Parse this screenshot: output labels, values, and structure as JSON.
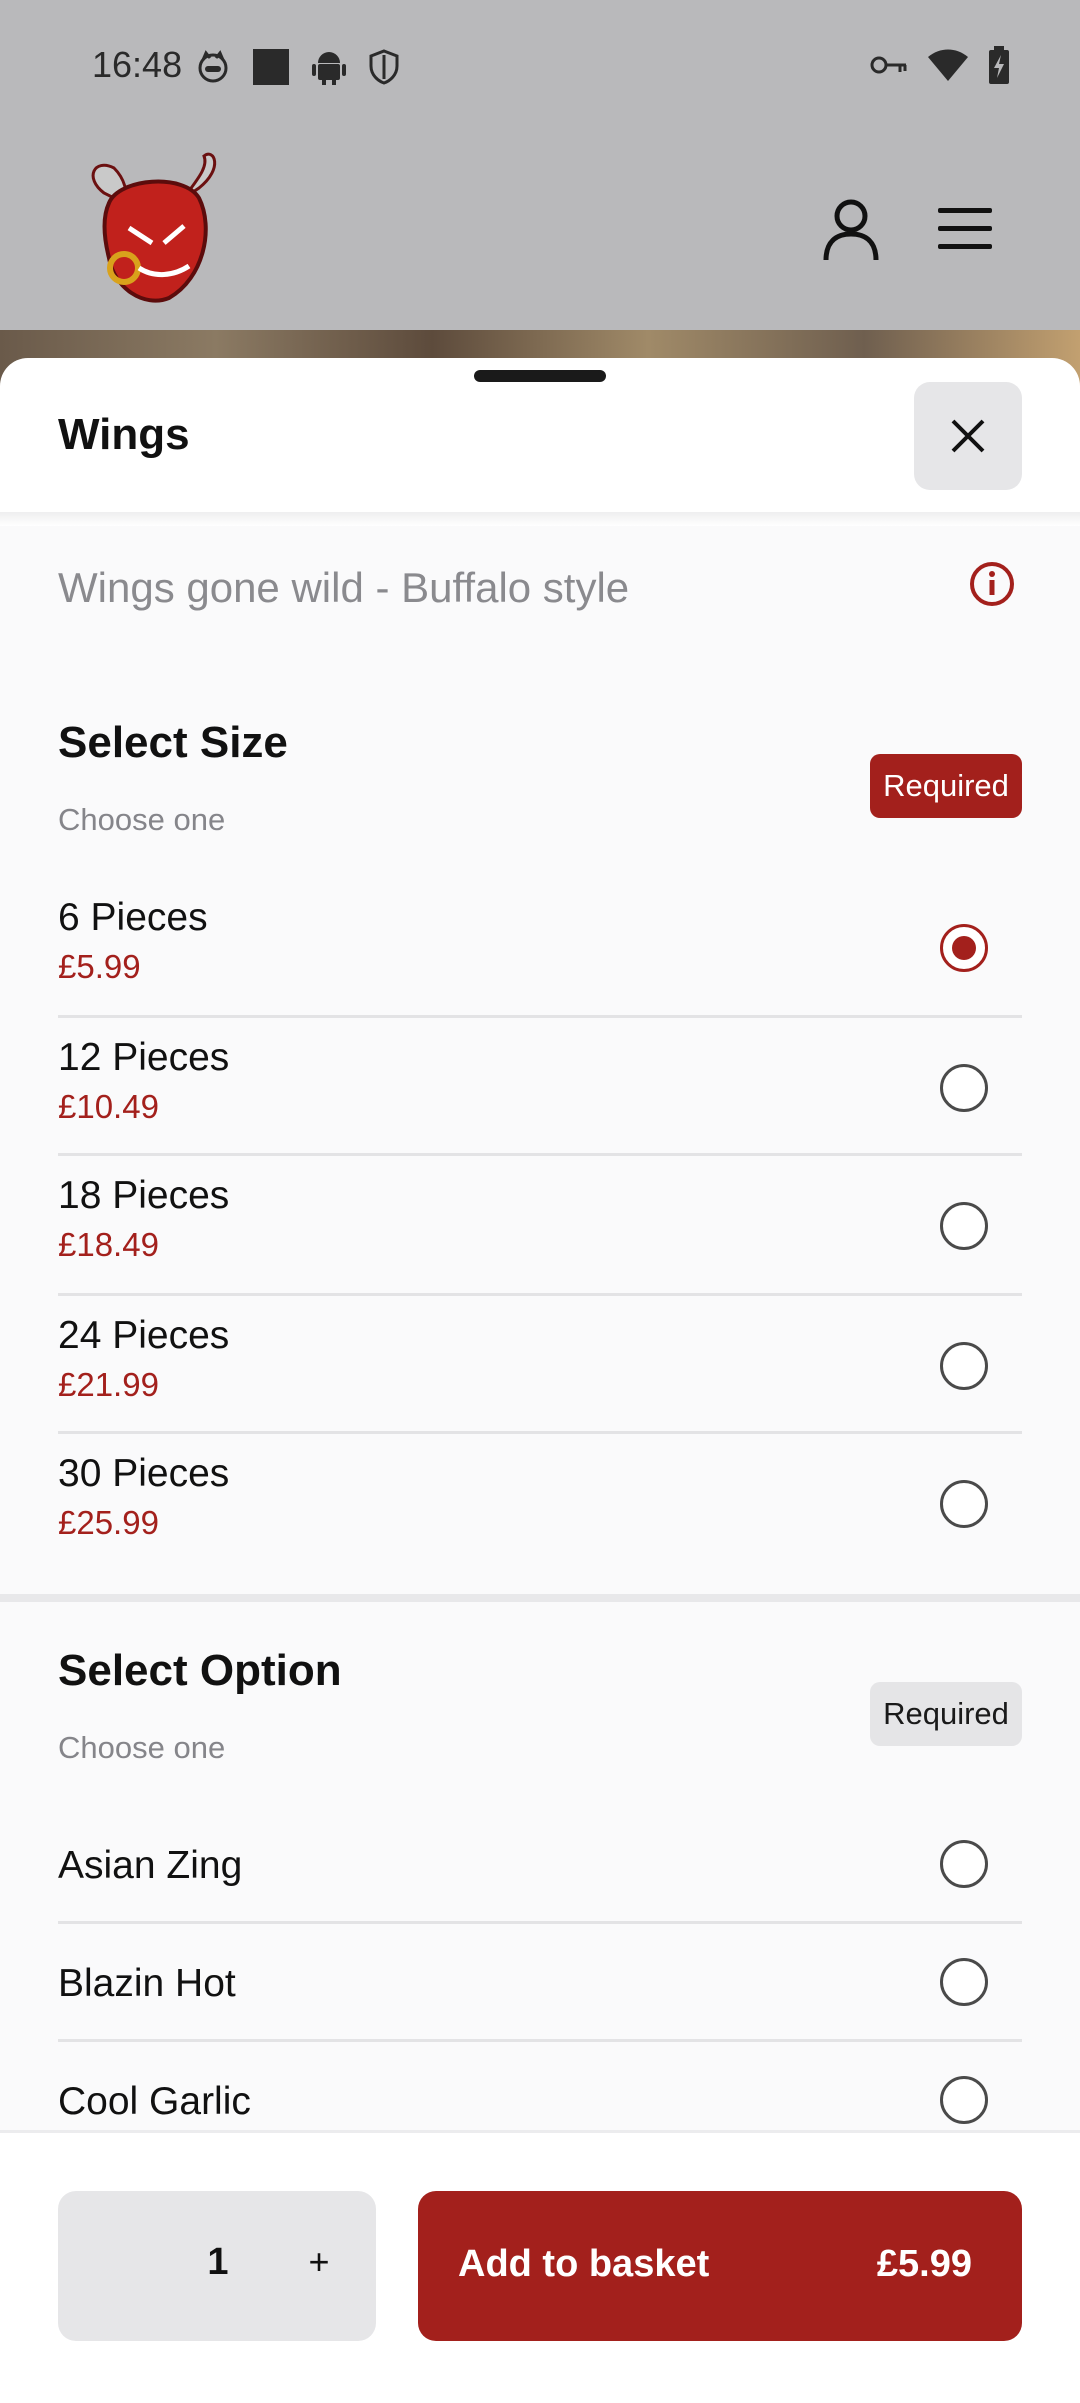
{
  "status_bar": {
    "time": "16:48",
    "left_icons": [
      "cat-face-icon",
      "square-icon",
      "android-icon",
      "shield-icon"
    ],
    "right_icons": [
      "key-icon",
      "wifi-icon",
      "battery-charging-icon"
    ]
  },
  "app_header": {
    "logo_icon": "bull-logo-icon",
    "account_icon": "user-icon",
    "menu_icon": "hamburger-menu-icon"
  },
  "sheet": {
    "title": "Wings",
    "description": "Wings gone wild - Buffalo style",
    "sections": [
      {
        "title": "Select Size",
        "subtitle": "Choose one",
        "badge": "Required",
        "options": [
          {
            "name": "6 Pieces",
            "price": "£5.99",
            "selected": true
          },
          {
            "name": "12 Pieces",
            "price": "£10.49",
            "selected": false
          },
          {
            "name": "18 Pieces",
            "price": "£18.49",
            "selected": false
          },
          {
            "name": "24 Pieces",
            "price": "£21.99",
            "selected": false
          },
          {
            "name": "30 Pieces",
            "price": "£25.99",
            "selected": false
          }
        ]
      },
      {
        "title": "Select Option",
        "subtitle": "Choose one",
        "badge": "Required",
        "options": [
          {
            "name": "Asian Zing",
            "selected": false
          },
          {
            "name": "Blazin Hot",
            "selected": false
          },
          {
            "name": "Cool Garlic",
            "selected": false
          }
        ]
      }
    ]
  },
  "footer": {
    "quantity": "1",
    "plus_label": "+",
    "add_label": "Add to basket",
    "add_price": "£5.99"
  },
  "colors": {
    "accent": "#a3201c",
    "badge_grey": "#e5e5e7",
    "scrim": "#b9b9bb"
  }
}
